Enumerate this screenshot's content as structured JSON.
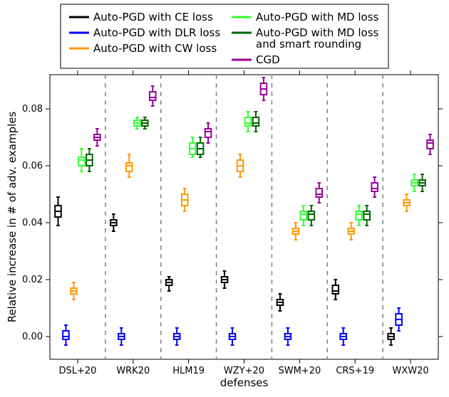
{
  "chart_data": {
    "type": "box",
    "xlabel": "defenses",
    "ylabel": "Relative increase in # of adv. examples",
    "ylim": [
      -0.008,
      0.092
    ],
    "yticks": [
      0.0,
      0.02,
      0.04,
      0.06,
      0.08
    ],
    "ytick_labels": [
      "0.00",
      "0.02",
      "0.04",
      "0.06",
      "0.08"
    ],
    "categories": [
      "DSL+20",
      "WRK20",
      "HLM19",
      "WZY+20",
      "SWM+20",
      "CRS+19",
      "WXW20"
    ],
    "series": [
      {
        "name": "Auto-PGD with CE loss",
        "color": "#000000",
        "boxes": [
          {
            "q1": 0.042,
            "median": 0.044,
            "q3": 0.046,
            "low": 0.039,
            "high": 0.049
          },
          {
            "q1": 0.039,
            "median": 0.04,
            "q3": 0.041,
            "low": 0.037,
            "high": 0.043
          },
          {
            "q1": 0.018,
            "median": 0.019,
            "q3": 0.02,
            "low": 0.016,
            "high": 0.021
          },
          {
            "q1": 0.019,
            "median": 0.02,
            "q3": 0.021,
            "low": 0.017,
            "high": 0.023
          },
          {
            "q1": 0.011,
            "median": 0.012,
            "q3": 0.013,
            "low": 0.009,
            "high": 0.015
          },
          {
            "q1": 0.015,
            "median": 0.016,
            "q3": 0.018,
            "low": 0.013,
            "high": 0.02
          },
          {
            "q1": -0.001,
            "median": 0.0,
            "q3": 0.001,
            "low": -0.003,
            "high": 0.003
          }
        ]
      },
      {
        "name": "Auto-PGD with DLR loss",
        "color": "#0000ff",
        "boxes": [
          {
            "q1": -0.001,
            "median": 0.0,
            "q3": 0.002,
            "low": -0.003,
            "high": 0.004
          },
          {
            "q1": -0.001,
            "median": 0.0,
            "q3": 0.001,
            "low": -0.003,
            "high": 0.003
          },
          {
            "q1": -0.001,
            "median": 0.0,
            "q3": 0.001,
            "low": -0.003,
            "high": 0.003
          },
          {
            "q1": -0.001,
            "median": 0.0,
            "q3": 0.001,
            "low": -0.003,
            "high": 0.003
          },
          {
            "q1": -0.001,
            "median": 0.0,
            "q3": 0.001,
            "low": -0.003,
            "high": 0.003
          },
          {
            "q1": -0.001,
            "median": 0.0,
            "q3": 0.001,
            "low": -0.003,
            "high": 0.003
          },
          {
            "q1": 0.004,
            "median": 0.006,
            "q3": 0.008,
            "low": 0.002,
            "high": 0.01
          }
        ]
      },
      {
        "name": "Auto-PGD with CW loss",
        "color": "#ff9900",
        "boxes": [
          {
            "q1": 0.015,
            "median": 0.016,
            "q3": 0.017,
            "low": 0.013,
            "high": 0.019
          },
          {
            "q1": 0.058,
            "median": 0.06,
            "q3": 0.061,
            "low": 0.056,
            "high": 0.064
          },
          {
            "q1": 0.046,
            "median": 0.048,
            "q3": 0.05,
            "low": 0.044,
            "high": 0.052
          },
          {
            "q1": 0.058,
            "median": 0.06,
            "q3": 0.062,
            "low": 0.056,
            "high": 0.064
          },
          {
            "q1": 0.036,
            "median": 0.037,
            "q3": 0.038,
            "low": 0.034,
            "high": 0.04
          },
          {
            "q1": 0.036,
            "median": 0.037,
            "q3": 0.038,
            "low": 0.034,
            "high": 0.04
          },
          {
            "q1": 0.046,
            "median": 0.047,
            "q3": 0.048,
            "low": 0.044,
            "high": 0.05
          }
        ]
      },
      {
        "name": "Auto-PGD with MD loss",
        "color": "#33ff33",
        "boxes": [
          {
            "q1": 0.06,
            "median": 0.062,
            "q3": 0.063,
            "low": 0.058,
            "high": 0.066
          },
          {
            "q1": 0.074,
            "median": 0.075,
            "q3": 0.076,
            "low": 0.073,
            "high": 0.077
          },
          {
            "q1": 0.064,
            "median": 0.066,
            "q3": 0.068,
            "low": 0.063,
            "high": 0.07
          },
          {
            "q1": 0.074,
            "median": 0.075,
            "q3": 0.077,
            "low": 0.072,
            "high": 0.079
          },
          {
            "q1": 0.041,
            "median": 0.043,
            "q3": 0.044,
            "low": 0.039,
            "high": 0.046
          },
          {
            "q1": 0.041,
            "median": 0.043,
            "q3": 0.044,
            "low": 0.039,
            "high": 0.046
          },
          {
            "q1": 0.053,
            "median": 0.054,
            "q3": 0.055,
            "low": 0.051,
            "high": 0.057
          }
        ]
      },
      {
        "name": "Auto-PGD with MD loss\n and smart rounding",
        "color": "#006400",
        "boxes": [
          {
            "q1": 0.06,
            "median": 0.062,
            "q3": 0.064,
            "low": 0.058,
            "high": 0.066
          },
          {
            "q1": 0.074,
            "median": 0.075,
            "q3": 0.076,
            "low": 0.073,
            "high": 0.077
          },
          {
            "q1": 0.064,
            "median": 0.066,
            "q3": 0.068,
            "low": 0.063,
            "high": 0.07
          },
          {
            "q1": 0.074,
            "median": 0.075,
            "q3": 0.077,
            "low": 0.072,
            "high": 0.079
          },
          {
            "q1": 0.041,
            "median": 0.043,
            "q3": 0.044,
            "low": 0.039,
            "high": 0.046
          },
          {
            "q1": 0.041,
            "median": 0.043,
            "q3": 0.044,
            "low": 0.039,
            "high": 0.046
          },
          {
            "q1": 0.053,
            "median": 0.054,
            "q3": 0.055,
            "low": 0.051,
            "high": 0.057
          }
        ]
      },
      {
        "name": "CGD",
        "color": "#990099",
        "boxes": [
          {
            "q1": 0.069,
            "median": 0.07,
            "q3": 0.071,
            "low": 0.067,
            "high": 0.073
          },
          {
            "q1": 0.083,
            "median": 0.084,
            "q3": 0.086,
            "low": 0.081,
            "high": 0.088
          },
          {
            "q1": 0.07,
            "median": 0.072,
            "q3": 0.073,
            "low": 0.068,
            "high": 0.075
          },
          {
            "q1": 0.085,
            "median": 0.087,
            "q3": 0.089,
            "low": 0.083,
            "high": 0.091
          },
          {
            "q1": 0.049,
            "median": 0.05,
            "q3": 0.052,
            "low": 0.047,
            "high": 0.054
          },
          {
            "q1": 0.051,
            "median": 0.052,
            "q3": 0.054,
            "low": 0.049,
            "high": 0.056
          },
          {
            "q1": 0.066,
            "median": 0.068,
            "q3": 0.069,
            "low": 0.064,
            "high": 0.071
          }
        ]
      }
    ],
    "legend_position": "top"
  }
}
